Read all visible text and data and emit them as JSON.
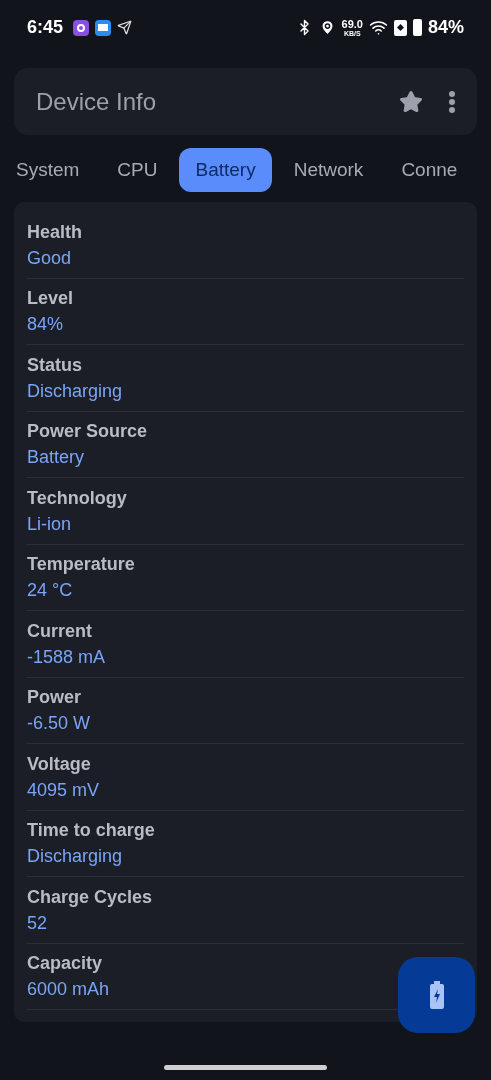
{
  "status_bar": {
    "time": "6:45",
    "net_speed": "69.0",
    "net_unit": "KB/S",
    "battery": "84%"
  },
  "app_bar": {
    "title": "Device Info"
  },
  "tabs": [
    {
      "label": "System",
      "selected": false
    },
    {
      "label": "CPU",
      "selected": false
    },
    {
      "label": "Battery",
      "selected": true
    },
    {
      "label": "Network",
      "selected": false
    },
    {
      "label": "Conne",
      "selected": false
    }
  ],
  "rows": [
    {
      "label": "Health",
      "value": "Good"
    },
    {
      "label": "Level",
      "value": "84%"
    },
    {
      "label": "Status",
      "value": "Discharging"
    },
    {
      "label": "Power Source",
      "value": "Battery"
    },
    {
      "label": "Technology",
      "value": "Li-ion"
    },
    {
      "label": "Temperature",
      "value": "24 °C"
    },
    {
      "label": "Current",
      "value": "-1588 mA"
    },
    {
      "label": "Power",
      "value": "-6.50 W"
    },
    {
      "label": "Voltage",
      "value": "4095 mV"
    },
    {
      "label": "Time to charge",
      "value": "Discharging"
    },
    {
      "label": "Charge Cycles",
      "value": "52"
    },
    {
      "label": "Capacity",
      "value": "6000 mAh"
    }
  ]
}
